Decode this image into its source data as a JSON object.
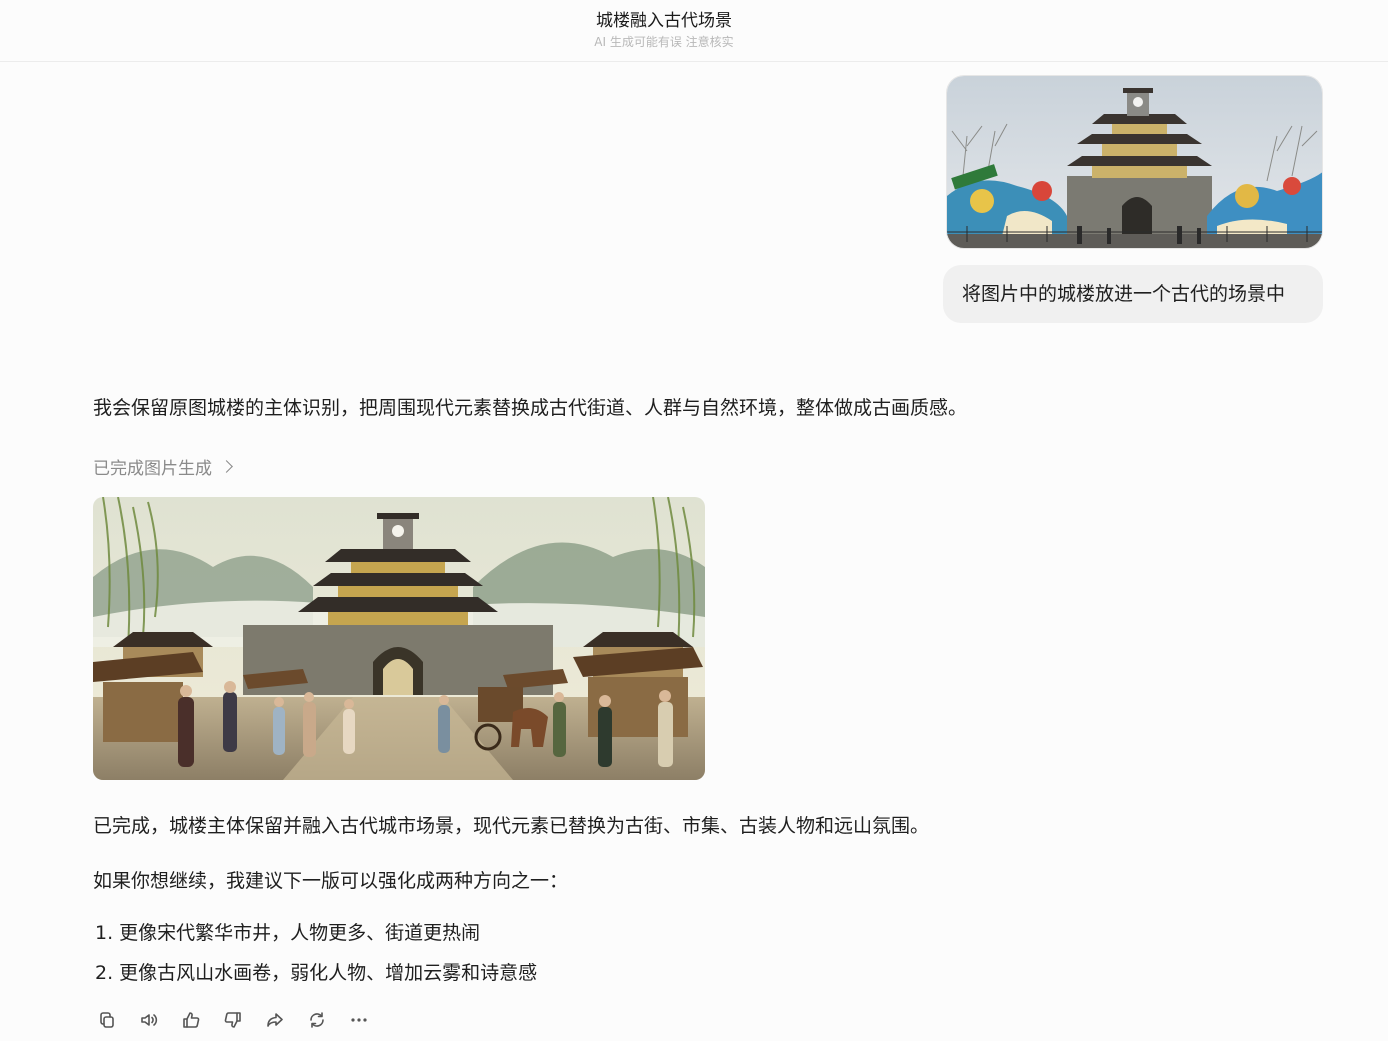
{
  "header": {
    "title": "城楼融入古代场景",
    "subtitle": "AI 生成可能有误 注意核实"
  },
  "user_message": {
    "image_alt": "城楼照片",
    "text": "将图片中的城楼放进一个古代的场景中"
  },
  "assistant": {
    "intro": "我会保留原图城楼的主体识别，把周围现代元素替换成古代街道、人群与自然环境，整体做成古画质感。",
    "status": "已完成图片生成",
    "image_alt": "古代场景城楼",
    "summary": "已完成，城楼主体保留并融入古代城市场景，现代元素已替换为古街、市集、古装人物和远山氛围。",
    "suggest": "如果你想继续，我建议下一版可以强化成两种方向之一：",
    "options": [
      "1. 更像宋代繁华市井，人物更多、街道更热闹",
      "2. 更像古风山水画卷，弱化人物、增加云雾和诗意感"
    ]
  },
  "actions": [
    {
      "icon": "copy-icon"
    },
    {
      "icon": "speaker-icon"
    },
    {
      "icon": "thumbs-up-icon"
    },
    {
      "icon": "thumbs-down-icon"
    },
    {
      "icon": "share-icon"
    },
    {
      "icon": "regenerate-icon"
    },
    {
      "icon": "more-icon"
    }
  ]
}
